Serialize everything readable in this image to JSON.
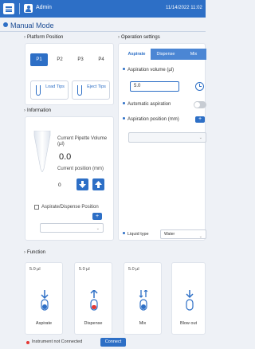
{
  "header": {
    "user": "Admin",
    "datetime": "11/14/2022 11:02",
    "title": "Manual Mode"
  },
  "platform": {
    "title": "Platform Position",
    "positions": [
      "P1",
      "P2",
      "P3",
      "P4"
    ],
    "active": "P1",
    "load_label": "Load Tips",
    "eject_label": "Eject Tips"
  },
  "information": {
    "title": "Information",
    "volume_label": "Current Pipette Volume (µl)",
    "volume_value": "0.0",
    "position_label": "Current position (mm)",
    "position_value": "0",
    "aspdisp_label": "Aspirate/Dispense Position"
  },
  "operation": {
    "title": "Operation settings",
    "tabs": [
      "Aspirate",
      "Dispense",
      "Mix"
    ],
    "aspiration_volume_label": "Aspiration volume (µl)",
    "aspiration_volume_value": "5.0",
    "automatic_aspiration_label": "Automatic aspiration",
    "aspiration_position_label": "Aspiration position (mm)",
    "liquid_type_label": "Liquid type",
    "liquid_type_value": "Water"
  },
  "function": {
    "title": "Function",
    "cards": [
      {
        "volume": "5.0 µl",
        "name": "Aspirate"
      },
      {
        "volume": "5.0 µl",
        "name": "Dispense"
      },
      {
        "volume": "5.0 µl",
        "name": "Mix"
      },
      {
        "volume": "",
        "name": "Blow out"
      }
    ]
  },
  "status": {
    "text": "Instrument not Connected",
    "connect_label": "Connect"
  },
  "colors": {
    "accent": "#2d6fc6",
    "error": "#e53935",
    "background": "#eef1f6"
  }
}
